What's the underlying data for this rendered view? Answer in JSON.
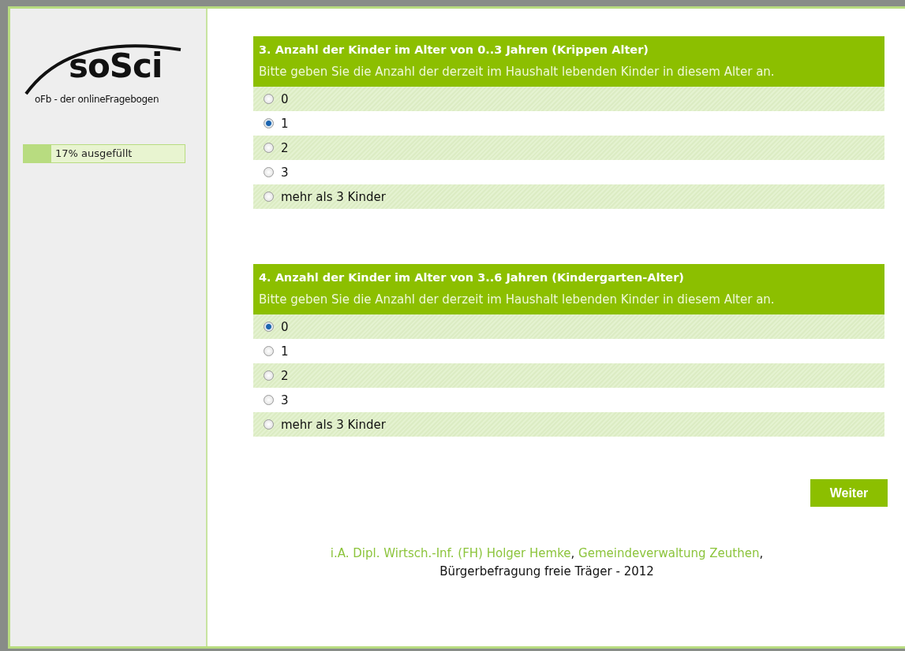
{
  "logo": {
    "name": "soSci",
    "tagline": "oFb - der onlineFragebogen"
  },
  "progress": {
    "label": "17% ausgefüllt",
    "level": 0.17
  },
  "questions": [
    {
      "title": "3. Anzahl der Kinder im Alter von 0..3 Jahren (Krippen Alter)",
      "instruction": "Bitte geben Sie die Anzahl der derzeit im Haushalt lebenden Kinder in diesem Alter an.",
      "options": [
        {
          "label": "0",
          "selected": false
        },
        {
          "label": "1",
          "selected": true
        },
        {
          "label": "2",
          "selected": false
        },
        {
          "label": "3",
          "selected": false
        },
        {
          "label": "mehr als 3 Kinder",
          "selected": false
        }
      ]
    },
    {
      "title": "4. Anzahl der Kinder im Alter von 3..6 Jahren (Kindergarten-Alter)",
      "instruction": "Bitte geben Sie die Anzahl der derzeit im Haushalt lebenden Kinder in diesem Alter an.",
      "options": [
        {
          "label": "0",
          "selected": true
        },
        {
          "label": "1",
          "selected": false
        },
        {
          "label": "2",
          "selected": false
        },
        {
          "label": "3",
          "selected": false
        },
        {
          "label": "mehr als 3 Kinder",
          "selected": false
        }
      ]
    }
  ],
  "next_button": "Weiter",
  "footer": {
    "parts": [
      {
        "kind": "link",
        "text": "i.A. Dipl. Wirtsch.-Inf. (FH) Holger Hemke"
      },
      {
        "kind": "plain",
        "text": ", "
      },
      {
        "kind": "link",
        "text": "Gemeindeverwaltung Zeuthen"
      },
      {
        "kind": "plain",
        "text": ","
      }
    ],
    "line2": "Bürgerbefragung freie Träger - 2012"
  }
}
